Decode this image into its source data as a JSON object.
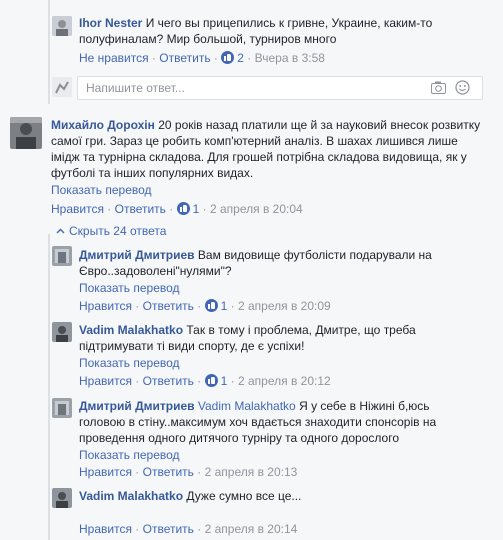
{
  "comments": {
    "ihor": {
      "author": "Ihor Nester",
      "lines": [
        "И чего вы прицепились к гривне, Украине, каким-то",
        "полуфиналам? Мир большой, турниров много"
      ],
      "unlike": "Не нравится",
      "reply": "Ответить",
      "likes": "2",
      "time": "Вчера в 3:58"
    },
    "reply_input": {
      "placeholder": "Напишите ответ..."
    },
    "mykhailo": {
      "author": "Михайло Дорохін",
      "lines": [
        "20 років назад платили ще й за науковий внесок розвитку",
        "самої гри. Зараз це робить комп'ютерний аналіз. В шахах лишився лише",
        "імідж та турнірна складова. Для грошей потрібна складова видовища, як у",
        "футболі та інших популярних видах."
      ],
      "show_translation": "Показать перевод",
      "like": "Нравится",
      "reply": "Ответить",
      "likes": "1",
      "time": "2 апреля в 20:04"
    },
    "hide_replies": "Скрыть 24 ответа",
    "replies": [
      {
        "author": "Дмитрий Дмитриев",
        "lines": [
          "Вам видовище футболісти подарували на",
          "Євро..задоволені\"нулями\"?"
        ],
        "show_translation": "Показать перевод",
        "like": "Нравится",
        "reply": "Ответить",
        "likes": "1",
        "time": "2 апреля в 20:09"
      },
      {
        "author": "Vadim Malakhatko",
        "lines": [
          "Так в тому і проблема, Дмитре, що треба",
          "підтримувати ті види спорту, де є успіхи!"
        ],
        "show_translation": "Показать перевод",
        "like": "Нравится",
        "reply": "Ответить",
        "likes": "1",
        "time": "2 апреля в 20:12"
      },
      {
        "author": "Дмитрий Дмитриев",
        "mention": "Vadim Malakhatko",
        "lines": [
          "Я у себе в Ніжині б,юсь",
          "головою в стіну..максимум хоч вдається знаходити спонсорів на",
          "проведення одного дитячого турніру та одного дорослого"
        ],
        "show_translation": "Показать перевод",
        "like": "Нравится",
        "reply": "Ответить",
        "time": "2 апреля в 20:13"
      },
      {
        "author": "Vadim Malakhatko",
        "lines": [
          "Дуже сумно все це..."
        ],
        "like": "Нравится",
        "reply": "Ответить",
        "time": "2 апреля в 20:14"
      }
    ]
  },
  "colors": {
    "name": "#365899",
    "link": "#4267b2",
    "meta": "#90949c",
    "background": "#f6f7f9"
  },
  "icons": [
    "like-icon",
    "camera-icon",
    "emoji-icon",
    "collapse-arrow-icon"
  ]
}
